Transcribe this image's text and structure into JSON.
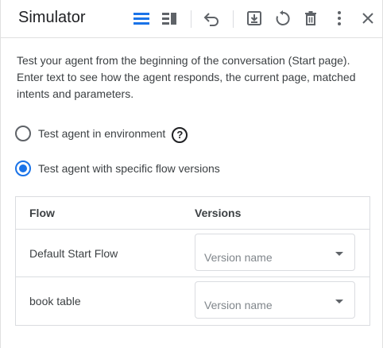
{
  "header": {
    "title": "Simulator",
    "icons": [
      "list-view-icon",
      "split-view-icon",
      "undo-icon",
      "export-icon",
      "reset-icon",
      "delete-icon",
      "more-vert-icon",
      "close-icon"
    ],
    "accent": "#1a73e8"
  },
  "description": "Test your agent from the beginning of the conversation (Start page). Enter text to see how the agent responds, the current page, matched intents and parameters.",
  "options": {
    "environment": {
      "label": "Test agent in environment",
      "selected": false
    },
    "flow_versions": {
      "label": "Test agent with specific flow versions",
      "selected": true
    }
  },
  "table": {
    "headers": {
      "flow": "Flow",
      "versions": "Versions"
    },
    "rows": [
      {
        "flow": "Default Start Flow",
        "version_placeholder": "Version name"
      },
      {
        "flow": "book table",
        "version_placeholder": "Version name"
      }
    ]
  }
}
